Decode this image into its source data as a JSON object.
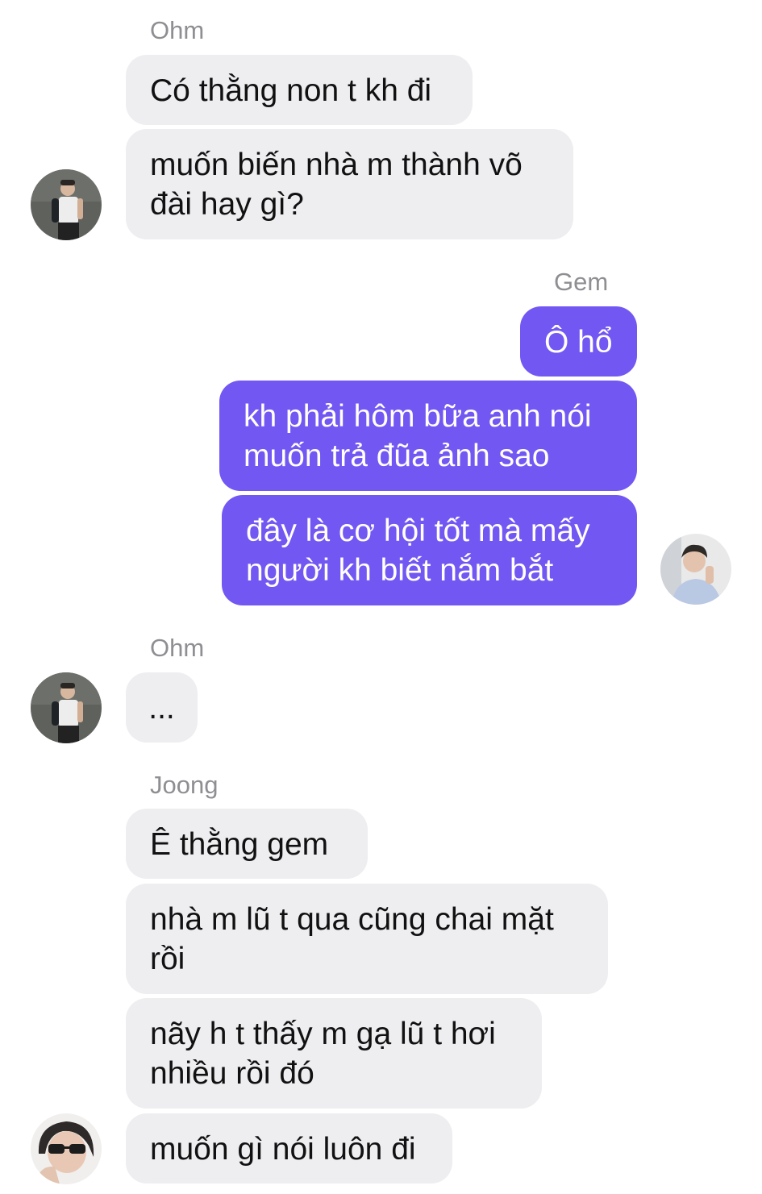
{
  "colors": {
    "incoming_bubble": "#eeeef1",
    "outgoing_bubble": "#7257f2",
    "sender_name": "#8e8e93"
  },
  "messages": [
    {
      "sender": "Ohm",
      "text": "Có thằng non t kh đi",
      "direction": "incoming"
    },
    {
      "sender": "Ohm",
      "text": "muốn biến nhà m thành võ\nđài hay gì?",
      "direction": "incoming"
    },
    {
      "sender": "Gem",
      "text": "Ô hổ",
      "direction": "outgoing"
    },
    {
      "sender": "Gem",
      "text": "kh phải hôm bữa anh nói\nmuốn trả đũa ảnh sao",
      "direction": "outgoing"
    },
    {
      "sender": "Gem",
      "text": "đây là cơ hội tốt mà mấy\nngười kh biết nắm bắt",
      "direction": "outgoing"
    },
    {
      "sender": "Ohm",
      "text": "...",
      "direction": "incoming"
    },
    {
      "sender": "Joong",
      "text": "Ê thằng gem",
      "direction": "incoming"
    },
    {
      "sender": "Joong",
      "text": "nhà m lũ t qua cũng chai mặt\nrồi",
      "direction": "incoming"
    },
    {
      "sender": "Joong",
      "text": "nãy h t thấy m gạ lũ t hơi\nnhiều rồi đó",
      "direction": "incoming"
    },
    {
      "sender": "Joong",
      "text": "muốn gì nói luôn đi",
      "direction": "incoming"
    }
  ],
  "avatars": [
    "avatar-ohm",
    "avatar-gem",
    "avatar-joong"
  ]
}
